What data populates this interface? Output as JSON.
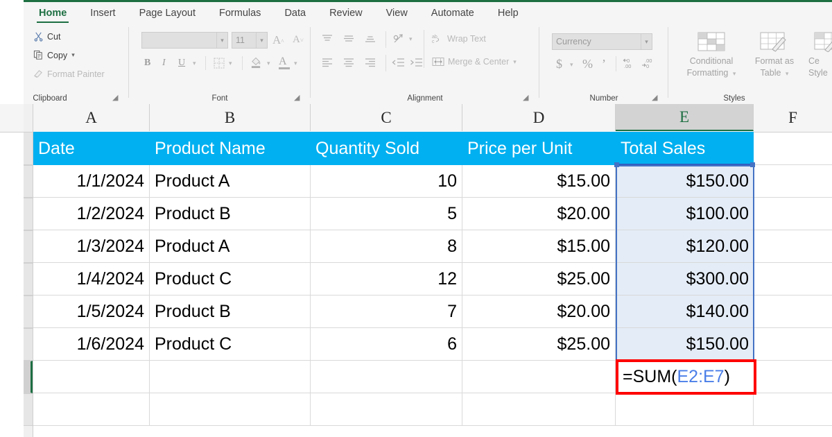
{
  "app": {
    "accent_green": "#1d6f42",
    "header_fill": "#00b0f0",
    "selection_fill": "#e4ecf7",
    "selection_border": "#4472c4",
    "highlight_red": "#ff0000"
  },
  "ribbon": {
    "tabs": [
      {
        "label": "Home",
        "active": true
      },
      {
        "label": "Insert",
        "active": false
      },
      {
        "label": "Page Layout",
        "active": false
      },
      {
        "label": "Formulas",
        "active": false
      },
      {
        "label": "Data",
        "active": false
      },
      {
        "label": "Review",
        "active": false
      },
      {
        "label": "View",
        "active": false
      },
      {
        "label": "Automate",
        "active": false
      },
      {
        "label": "Help",
        "active": false
      }
    ],
    "groups": {
      "clipboard": {
        "label": "Clipboard",
        "cut": "Cut",
        "copy": "Copy",
        "format_painter": "Format Painter"
      },
      "font": {
        "label": "Font",
        "font_name_value": "",
        "font_size_value": "11",
        "bold": "B",
        "italic": "I",
        "underline": "U"
      },
      "alignment": {
        "label": "Alignment",
        "wrap_text": "Wrap Text",
        "merge_center": "Merge & Center"
      },
      "number": {
        "label": "Number",
        "format_value": "Currency",
        "currency": "$",
        "percent": "%",
        "comma": "’"
      },
      "styles": {
        "label": "Styles",
        "conditional_formatting": "Conditional\nFormatting",
        "conditional_formatting_l1": "Conditional",
        "conditional_formatting_l2": "Formatting",
        "format_as_table_l1": "Format as",
        "format_as_table_l2": "Table",
        "cell_styles_l1": "Ce",
        "cell_styles_l2": "Style"
      }
    }
  },
  "sheet": {
    "column_headers": [
      {
        "letter": "A",
        "selected": false
      },
      {
        "letter": "B",
        "selected": false
      },
      {
        "letter": "C",
        "selected": false
      },
      {
        "letter": "D",
        "selected": false
      },
      {
        "letter": "E",
        "selected": true
      },
      {
        "letter": "F",
        "selected": false
      }
    ],
    "header_row": [
      "Date",
      "Product Name",
      "Quantity Sold",
      "Price per Unit",
      "Total Sales"
    ],
    "rows": [
      {
        "date": "1/1/2024",
        "product": "Product A",
        "qty": "10",
        "price": "$15.00",
        "total": "$150.00"
      },
      {
        "date": "1/2/2024",
        "product": "Product B",
        "qty": "5",
        "price": "$20.00",
        "total": "$100.00"
      },
      {
        "date": "1/3/2024",
        "product": "Product A",
        "qty": "8",
        "price": "$15.00",
        "total": "$120.00"
      },
      {
        "date": "1/4/2024",
        "product": "Product C",
        "qty": "12",
        "price": "$25.00",
        "total": "$300.00"
      },
      {
        "date": "1/5/2024",
        "product": "Product B",
        "qty": "7",
        "price": "$20.00",
        "total": "$140.00"
      },
      {
        "date": "1/6/2024",
        "product": "Product C",
        "qty": "6",
        "price": "$25.00",
        "total": "$150.00"
      }
    ],
    "selected_range": "E2:E7",
    "formula_cell": {
      "prefix": "=SUM(",
      "reference": "E2:E7",
      "suffix": ")"
    }
  }
}
